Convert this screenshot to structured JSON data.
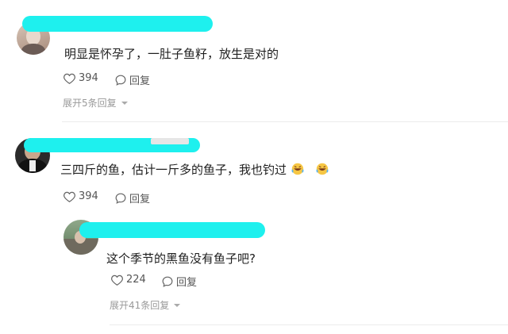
{
  "comments": [
    {
      "text": "明显是怀孕了，一肚子鱼籽，放生是对的",
      "likes": "394",
      "reply_label": "回复",
      "expand_label": "展开5条回复"
    },
    {
      "text": "三四斤的鱼，估计一斤多的鱼子，我也钓过",
      "likes": "394",
      "reply_label": "回复",
      "reply": {
        "text": "这个季节的黑鱼没有鱼子吧?",
        "likes": "224",
        "reply_label": "回复",
        "expand_label": "展开41条回复"
      }
    }
  ],
  "icons": {
    "like": "heart-outline-icon",
    "reply": "speech-bubble-icon",
    "expand": "chevron-down-icon",
    "emoji": "laughing-tears-emoji"
  },
  "colors": {
    "redaction": "#1ef0ee",
    "meta_text": "#999999"
  }
}
